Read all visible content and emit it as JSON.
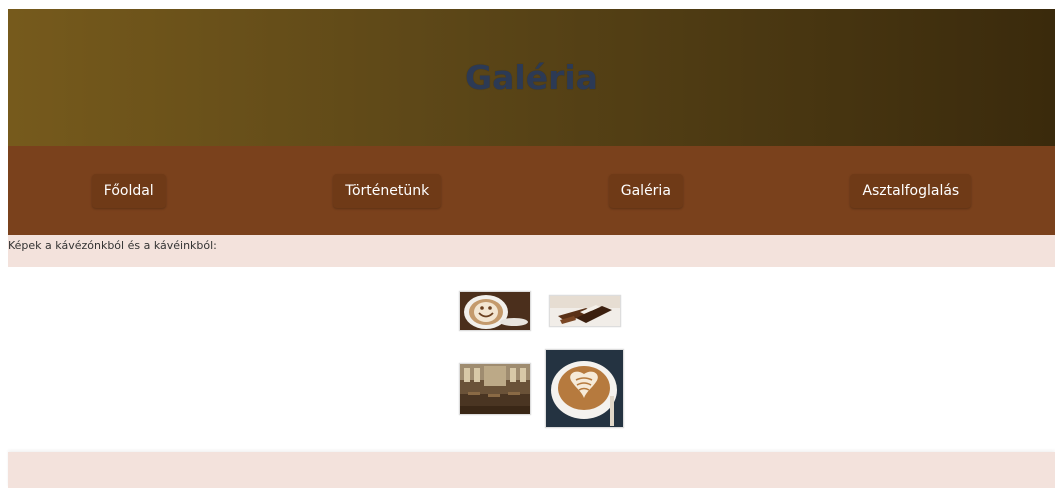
{
  "header": {
    "title": "Galéria"
  },
  "nav": {
    "items": [
      {
        "label": "Főoldal"
      },
      {
        "label": "Történetünk"
      },
      {
        "label": "Galéria"
      },
      {
        "label": "Asztalfoglalás"
      }
    ]
  },
  "intro": {
    "text": "Képek a kávézónkból és a kávéinkból:"
  },
  "gallery": {
    "images": [
      {
        "subject": "smiley-latte-art"
      },
      {
        "subject": "chocolate-pieces"
      },
      {
        "subject": "cafe-interior"
      },
      {
        "subject": "heart-latte-art"
      }
    ]
  },
  "colors": {
    "header_start": "#765a1c",
    "header_end": "#3a2a0c",
    "title": "#2c3a55",
    "nav_bg": "#7a411c",
    "nav_button": "#6f3a17",
    "band_bg": "#f3e2dc"
  }
}
